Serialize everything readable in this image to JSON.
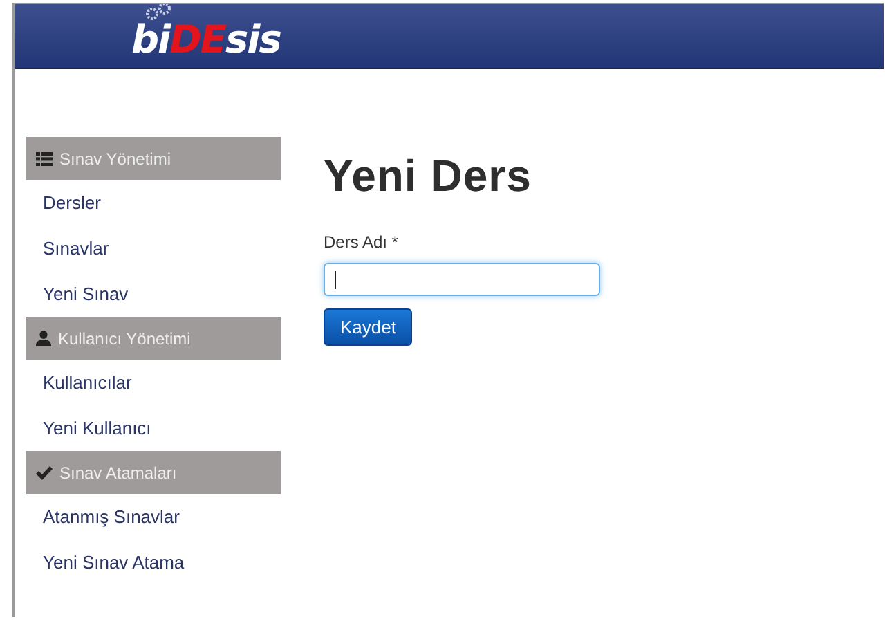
{
  "header": {
    "logo": [
      {
        "text": "bi",
        "color": "#ffffff"
      },
      {
        "text": "DE",
        "color": "#e3141c"
      },
      {
        "text": "sis",
        "color": "#ffffff"
      }
    ]
  },
  "sidebar": {
    "sections": [
      {
        "title": "Sınav Yönetimi",
        "items": [
          "Dersler",
          "Sınavlar",
          "Yeni Sınav"
        ]
      },
      {
        "title": "Kullanıcı Yönetimi",
        "items": [
          "Kullanıcılar",
          "Yeni Kullanıcı"
        ]
      },
      {
        "title": "Sınav Atamaları",
        "items": [
          "Atanmış Sınavlar",
          "Yeni Sınav Atama"
        ]
      }
    ]
  },
  "main": {
    "heading": "Yeni Ders",
    "field": {
      "label": "Ders Adı *",
      "focused": true
    },
    "button": "Kaydet"
  }
}
